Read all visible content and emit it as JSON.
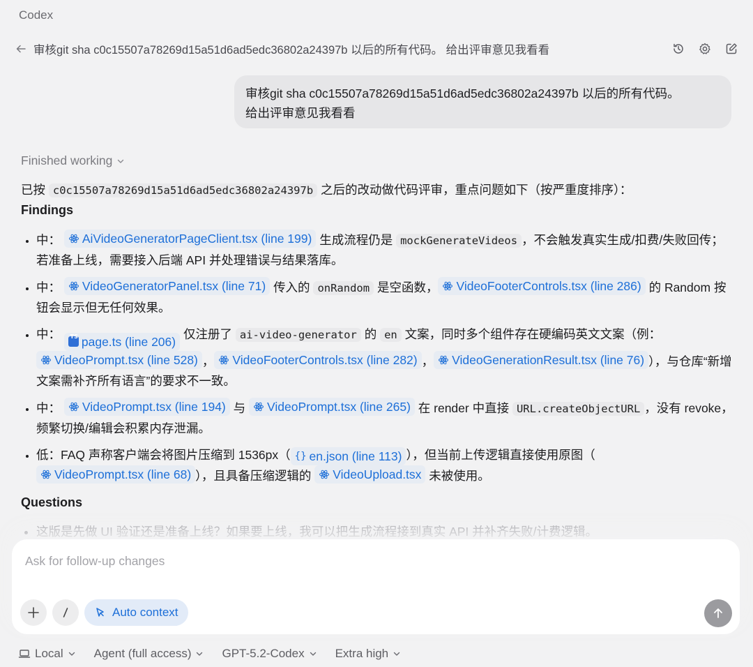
{
  "app": {
    "name": "Codex"
  },
  "header": {
    "title": "审核git sha c0c15507a78269d15a51d6ad5edc36802a24397b 以后的所有代码。 给出评审意见我看看",
    "icons": [
      "arrow-left-icon",
      "history-icon",
      "gear-icon",
      "edit-icon"
    ]
  },
  "user_message": {
    "line1": "审核git sha c0c15507a78269d15a51d6ad5edc36802a24397b 以后的所有代码。",
    "line2": "给出评审意见我看看"
  },
  "status": {
    "label": "Finished working"
  },
  "response": {
    "intro_prefix": "已按",
    "intro_sha": "c0c15507a78269d15a51d6ad5edc36802a24397b",
    "intro_suffix": "之后的改动做代码评审，重点问题如下（按严重度排序）：",
    "findings_heading": "Findings",
    "f1": {
      "level": "中：",
      "link1": "AiVideoGeneratorPageClient.tsx (line 199)",
      "t1": "生成流程仍是",
      "code1": "mockGenerateVideos",
      "t2": "，不会触发真实生成/扣费/失败回传；若准备上线，需要接入后端 API 并处理错误与结果落库。"
    },
    "f2": {
      "level": "中：",
      "link1": "VideoGeneratorPanel.tsx (line 71)",
      "t1": "传入的",
      "code1": "onRandom",
      "t2": "是空函数，",
      "link2": "VideoFooterControls.tsx (line 286)",
      "t3": "的 Random 按钮会显示但无任何效果。"
    },
    "f3": {
      "level": "中：",
      "link1": "page.ts (line 206)",
      "t1": "仅注册了",
      "code1": "ai-video-generator",
      "t2": "的",
      "code2": "en",
      "t3": "文案，同时多个组件存在硬编码英文文案（例：",
      "link2": "VideoPrompt.tsx (line 528)",
      "sep1": "，",
      "link3": "VideoFooterControls.tsx (line 282)",
      "sep2": "，",
      "link4": "VideoGenerationResult.tsx (line 76)",
      "t4": "），与仓库“新增文案需补齐所有语言”的要求不一致。"
    },
    "f4": {
      "level": "中：",
      "link1": "VideoPrompt.tsx (line 194)",
      "t1": "与",
      "link2": "VideoPrompt.tsx (line 265)",
      "t2": "在 render 中直接",
      "code1": "URL.createObjectURL",
      "t3": "，没有 revoke，频繁切换/编辑会积累内存泄漏。"
    },
    "f5": {
      "level": "低：",
      "t1": "FAQ 声称客户端会将图片压缩到 1536px（",
      "link1": "en.json (line 113)",
      "t2": "），但当前上传逻辑直接使用原图（",
      "link2": "VideoPrompt.tsx (line 68)",
      "t3": "），且具备压缩逻辑的",
      "link3": "VideoUpload.tsx",
      "t4": "未被使用。"
    },
    "questions_heading": "Questions",
    "q1": "这版是先做 UI 验证还是准备上线？如果要上线，我可以把生成流程接到真实 API 并补齐失败/计费逻辑。"
  },
  "composer": {
    "placeholder": "Ask for follow-up changes",
    "auto_context_label": "Auto context"
  },
  "footer": {
    "env": "Local",
    "agent": "Agent (full access)",
    "model": "GPT-5.2-Codex",
    "reasoning": "Extra high"
  }
}
